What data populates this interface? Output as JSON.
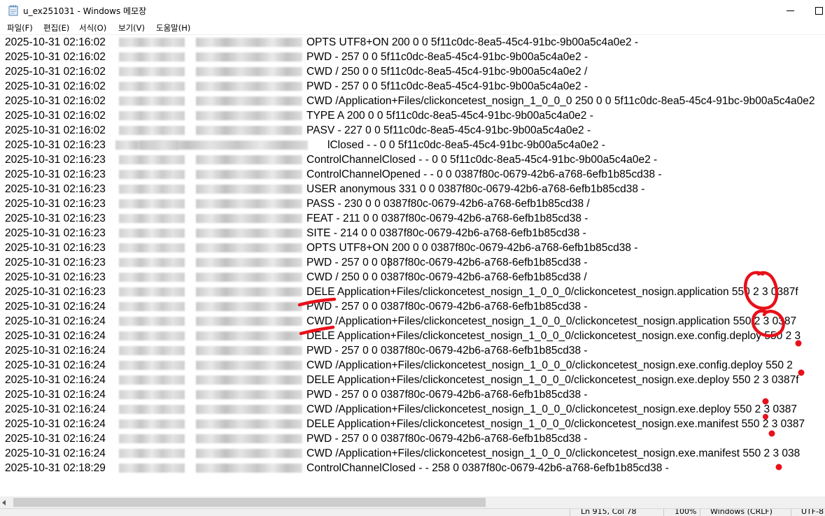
{
  "window": {
    "title": "u_ex251031 - Windows 메모장"
  },
  "menu": [
    "파일(F)",
    "편집(E)",
    "서식(O)",
    "보기(V)",
    "도움말(H)"
  ],
  "log_rows": [
    {
      "dt": "2025-10-31 02:16:02",
      "rest": "OPTS UTF8+ON 200 0 0 5f11c0dc-8ea5-45c4-91bc-9b00a5c4a0e2 -"
    },
    {
      "dt": "2025-10-31 02:16:02",
      "rest": "PWD - 257 0 0 5f11c0dc-8ea5-45c4-91bc-9b00a5c4a0e2 -"
    },
    {
      "dt": "2025-10-31 02:16:02",
      "rest": "CWD / 250 0 0 5f11c0dc-8ea5-45c4-91bc-9b00a5c4a0e2 /"
    },
    {
      "dt": "2025-10-31 02:16:02",
      "rest": "PWD - 257 0 0 5f11c0dc-8ea5-45c4-91bc-9b00a5c4a0e2 -"
    },
    {
      "dt": "2025-10-31 02:16:02",
      "rest": "CWD /Application+Files/clickoncetest_nosign_1_0_0_0 250 0 0 5f11c0dc-8ea5-45c4-91bc-9b00a5c4a0e2"
    },
    {
      "dt": "2025-10-31 02:16:02",
      "rest": "TYPE A 200 0 0 5f11c0dc-8ea5-45c4-91bc-9b00a5c4a0e2 -"
    },
    {
      "dt": "2025-10-31 02:16:02",
      "rest": "PASV - 227 0 0 5f11c0dc-8ea5-45c4-91bc-9b00a5c4a0e2 -"
    },
    {
      "dt": "2025-10-31 02:16:23",
      "rest": "lClosed - - 0 0 5f11c0dc-8ea5-45c4-91bc-9b00a5c4a0e2 -",
      "obscured": true
    },
    {
      "dt": "2025-10-31 02:16:23",
      "rest": "ControlChannelClosed - - 0 0 5f11c0dc-8ea5-45c4-91bc-9b00a5c4a0e2 -"
    },
    {
      "dt": "2025-10-31 02:16:23",
      "rest": "ControlChannelOpened - - 0 0 0387f80c-0679-42b6-a768-6efb1b85cd38 -"
    },
    {
      "dt": "2025-10-31 02:16:23",
      "rest": "USER anonymous 331 0 0 0387f80c-0679-42b6-a768-6efb1b85cd38 -"
    },
    {
      "dt": "2025-10-31 02:16:23",
      "rest": "PASS - 230 0 0 0387f80c-0679-42b6-a768-6efb1b85cd38 /"
    },
    {
      "dt": "2025-10-31 02:16:23",
      "rest": "FEAT - 211 0 0 0387f80c-0679-42b6-a768-6efb1b85cd38 -"
    },
    {
      "dt": "2025-10-31 02:16:23",
      "rest": "SITE - 214 0 0 0387f80c-0679-42b6-a768-6efb1b85cd38 -"
    },
    {
      "dt": "2025-10-31 02:16:23",
      "rest": "OPTS UTF8+ON 200 0 0 0387f80c-0679-42b6-a768-6efb1b85cd38 -"
    },
    {
      "dt": "2025-10-31 02:16:23",
      "rest": "PWD - 257 0 0 0387f80c-0679-42b6-a768-6efb1b85cd38 -"
    },
    {
      "dt": "2025-10-31 02:16:23",
      "rest": "CWD / 250 0 0 0387f80c-0679-42b6-a768-6efb1b85cd38 /"
    },
    {
      "dt": "2025-10-31 02:16:23",
      "rest": "DELE Application+Files/clickoncetest_nosign_1_0_0_0/clickoncetest_nosign.application 550 2 3 0387f"
    },
    {
      "dt": "2025-10-31 02:16:24",
      "rest": "PWD - 257 0 0 0387f80c-0679-42b6-a768-6efb1b85cd38 -"
    },
    {
      "dt": "2025-10-31 02:16:24",
      "rest": "CWD /Application+Files/clickoncetest_nosign_1_0_0_0/clickoncetest_nosign.application 550 2 3 0387"
    },
    {
      "dt": "2025-10-31 02:16:24",
      "rest": "DELE Application+Files/clickoncetest_nosign_1_0_0_0/clickoncetest_nosign.exe.config.deploy 550 2 3"
    },
    {
      "dt": "2025-10-31 02:16:24",
      "rest": "PWD - 257 0 0 0387f80c-0679-42b6-a768-6efb1b85cd38 -"
    },
    {
      "dt": "2025-10-31 02:16:24",
      "rest": "CWD /Application+Files/clickoncetest_nosign_1_0_0_0/clickoncetest_nosign.exe.config.deploy 550 2"
    },
    {
      "dt": "2025-10-31 02:16:24",
      "rest": "DELE Application+Files/clickoncetest_nosign_1_0_0_0/clickoncetest_nosign.exe.deploy 550 2 3 0387f"
    },
    {
      "dt": "2025-10-31 02:16:24",
      "rest": "PWD - 257 0 0 0387f80c-0679-42b6-a768-6efb1b85cd38 -"
    },
    {
      "dt": "2025-10-31 02:16:24",
      "rest": "CWD /Application+Files/clickoncetest_nosign_1_0_0_0/clickoncetest_nosign.exe.deploy 550 2 3 0387"
    },
    {
      "dt": "2025-10-31 02:16:24",
      "rest": "DELE Application+Files/clickoncetest_nosign_1_0_0_0/clickoncetest_nosign.exe.manifest 550 2 3 0387"
    },
    {
      "dt": "2025-10-31 02:16:24",
      "rest": "PWD - 257 0 0 0387f80c-0679-42b6-a768-6efb1b85cd38 -"
    },
    {
      "dt": "2025-10-31 02:16:24",
      "rest": "CWD /Application+Files/clickoncetest_nosign_1_0_0_0/clickoncetest_nosign.exe.manifest 550 2 3 038"
    },
    {
      "dt": "2025-10-31 02:18:29",
      "rest": "ControlChannelClosed - - 258 0 0387f80c-0679-42b6-a768-6efb1b85cd38 -"
    }
  ],
  "status_bar": {
    "position": "Ln 915, Col 78",
    "zoom": "100%",
    "line_ending": "Windows (CRLF)",
    "encoding": "UTF-8"
  },
  "colors": {
    "annotation": "#e8101a",
    "scrollbar_thumb": "#cdcdcd",
    "status_bg": "#f0f0f0"
  }
}
